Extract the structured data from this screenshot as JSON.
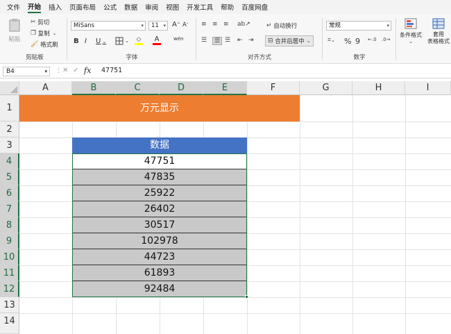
{
  "menu": [
    "文件",
    "开始",
    "插入",
    "页面布局",
    "公式",
    "数据",
    "审阅",
    "视图",
    "开发工具",
    "帮助",
    "百度网盘"
  ],
  "ribbon": {
    "clipboard": {
      "paste": "粘贴",
      "cut": "剪切",
      "copy": "复制",
      "format_painter": "格式刷",
      "label": "剪贴板"
    },
    "font": {
      "name": "MiSans",
      "size": "11",
      "grow": "A",
      "shrink": "A",
      "bold": "B",
      "italic": "I",
      "underline": "U",
      "font_color_glyph": "A",
      "wen": "wén",
      "label": "字体"
    },
    "align": {
      "wrap": "自动换行",
      "merge": "合并后居中",
      "label": "对齐方式"
    },
    "number": {
      "format": "常规",
      "percent": "%",
      "comma": "9",
      "label": "数字"
    },
    "styles": {
      "cond": "条件格式",
      "table": "套用\n表格格式"
    }
  },
  "formula_bar": {
    "name_box": "B4",
    "fx": "fx",
    "value": "47751"
  },
  "columns": [
    "A",
    "B",
    "C",
    "D",
    "E",
    "F",
    "G",
    "H",
    "I"
  ],
  "rows": [
    "1",
    "2",
    "3",
    "4",
    "5",
    "6",
    "7",
    "8",
    "9",
    "10",
    "11",
    "12",
    "13",
    "14"
  ],
  "sheet": {
    "title": "万元显示",
    "header": "数据",
    "values": [
      "47751",
      "47835",
      "25922",
      "26402",
      "30517",
      "102978",
      "44723",
      "61893",
      "92484"
    ]
  },
  "colors": {
    "title_bg": "#ed7d31",
    "header_bg": "#4472c4",
    "cell_bg": "#c9c9c9",
    "accent": "#217346"
  }
}
